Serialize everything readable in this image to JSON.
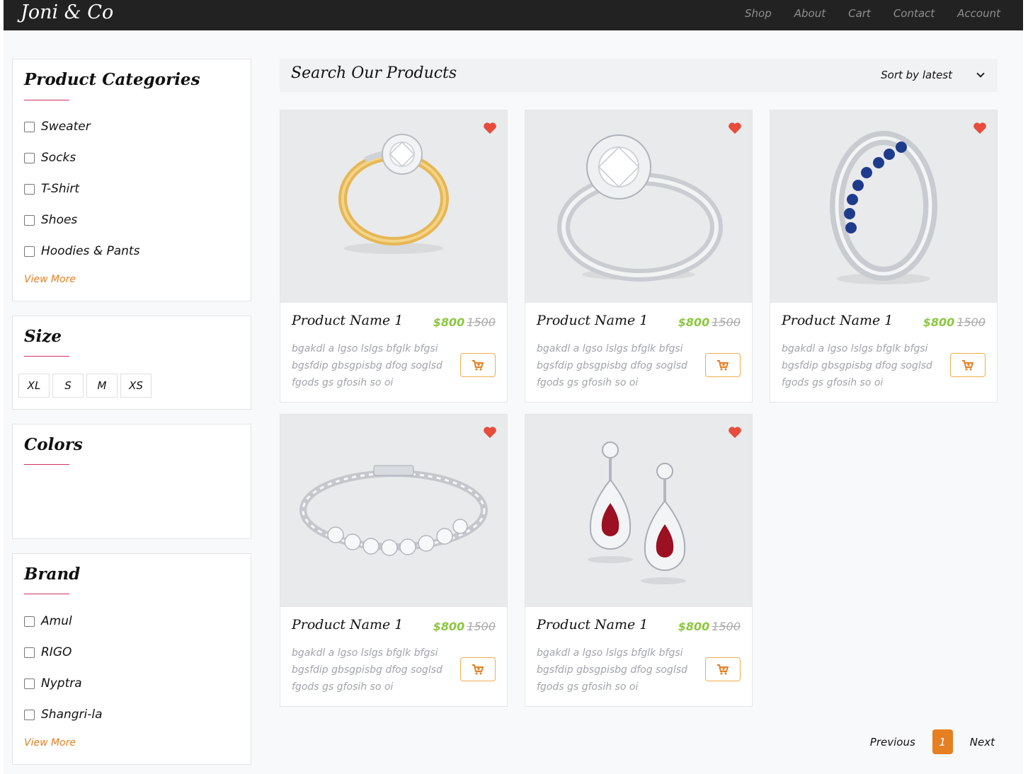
{
  "brand": "Joni & Co",
  "nav": [
    "Shop",
    "About",
    "Cart",
    "Contact",
    "Account"
  ],
  "sidebar": {
    "categories": {
      "title": "Product Categories",
      "items": [
        "Sweater",
        "Socks",
        "T-Shirt",
        "Shoes",
        "Hoodies & Pants"
      ],
      "view_more": "View More"
    },
    "size": {
      "title": "Size",
      "items": [
        "XL",
        "S",
        "M",
        "XS"
      ]
    },
    "colors": {
      "title": "Colors"
    },
    "brand": {
      "title": "Brand",
      "items": [
        "Amul",
        "RIGO",
        "Nyptra",
        "Shangri-la"
      ],
      "view_more": "View More"
    }
  },
  "search": {
    "title": "Search Our Products",
    "sort_label": "Sort by latest"
  },
  "products": [
    {
      "name": "Product Name 1",
      "price": "$800",
      "old_price": "1500",
      "description": "bgakdl a lgso lslgs bfglk bfgsi bgsfdip gbsgpisbg dfog soglsd fgods gs gfosih so oi",
      "image": "gold-diamond-ring"
    },
    {
      "name": "Product Name 1",
      "price": "$800",
      "old_price": "1500",
      "description": "bgakdl a lgso lslgs bfglk bfgsi bgsfdip gbsgpisbg dfog soglsd fgods gs gfosih so oi",
      "image": "silver-solitaire-ring"
    },
    {
      "name": "Product Name 1",
      "price": "$800",
      "old_price": "1500",
      "description": "bgakdl a lgso lslgs bfglk bfgsi bgsfdip gbsgpisbg dfog soglsd fgods gs gfosih so oi",
      "image": "sapphire-band-ring"
    },
    {
      "name": "Product Name 1",
      "price": "$800",
      "old_price": "1500",
      "description": "bgakdl a lgso lslgs bfglk bfgsi bgsfdip gbsgpisbg dfog soglsd fgods gs gfosih so oi",
      "image": "diamond-tennis-bracelet"
    },
    {
      "name": "Product Name 1",
      "price": "$800",
      "old_price": "1500",
      "description": "bgakdl a lgso lslgs bfglk bfgsi bgsfdip gbsgpisbg dfog soglsd fgods gs gfosih so oi",
      "image": "ruby-drop-earrings"
    }
  ],
  "pagination": {
    "previous": "Previous",
    "current": "1",
    "next": "Next"
  },
  "colors": {
    "navbar": "#222222",
    "accent_orange": "#e67e22",
    "price_green": "#8cc63f",
    "heart_red": "#e74c3c",
    "title_underline": "#d2335a"
  }
}
